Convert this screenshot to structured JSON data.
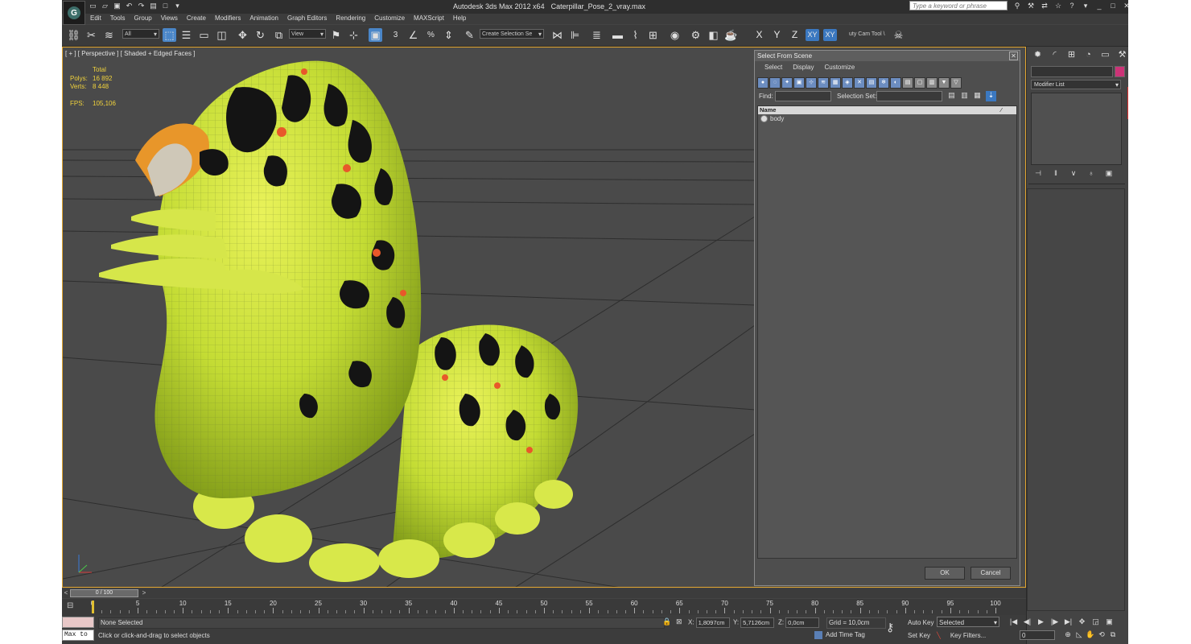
{
  "app": {
    "logo_letter": "G",
    "title": "Autodesk 3ds Max  2012 x64",
    "file": "Caterpillar_Pose_2_vray.max",
    "search_placeholder": "Type a keyword or phrase"
  },
  "menu": [
    "Edit",
    "Tools",
    "Group",
    "Views",
    "Create",
    "Modifiers",
    "Animation",
    "Graph Editors",
    "Rendering",
    "Customize",
    "MAXScript",
    "Help"
  ],
  "toolbar": {
    "filter_value": "All",
    "refcoord_value": "View",
    "selection_set": "Create Selection Se",
    "num_label": "3",
    "axes": [
      "X",
      "Y",
      "Z",
      "XY",
      "XY"
    ],
    "ribbon_label": "uty Cam Tool \\"
  },
  "viewport": {
    "label": "[ + ] [ Perspective ] [ Shaded + Edged Faces ]",
    "stats": {
      "total_label": "Total",
      "polys_label": "Polys:",
      "polys_value": "16 892",
      "verts_label": "Verts:",
      "verts_value": "8 448",
      "fps_label": "FPS:",
      "fps_value": "105,106"
    },
    "gizmo": {
      "x": "x",
      "y": "y",
      "z": "z"
    }
  },
  "dialog": {
    "title": "Select From Scene",
    "menu": [
      "Select",
      "Display",
      "Customize"
    ],
    "find_label": "Find:",
    "selection_set_label": "Selection Set:",
    "column_name": "Name",
    "rows": [
      "body"
    ],
    "ok_label": "OK",
    "cancel_label": "Cancel"
  },
  "command_panel": {
    "modifier_list": "Modifier List"
  },
  "timeline": {
    "slider_label": "0 / 100",
    "ticks": [
      0,
      5,
      10,
      15,
      20,
      25,
      30,
      35,
      40,
      45,
      50,
      55,
      60,
      65,
      70,
      75,
      80,
      85,
      90,
      95,
      100
    ],
    "max_frame": 100
  },
  "status": {
    "max_to": "Max to",
    "selection": "None Selected",
    "prompt": "Click or click-and-drag to select objects",
    "x_label": "X:",
    "x_value": "1,8097cm",
    "y_label": "Y:",
    "y_value": "5,7126cm",
    "z_label": "Z:",
    "z_value": "0,0cm",
    "grid": "Grid = 10,0cm",
    "add_time_tag": "Add Time Tag",
    "auto_key": "Auto Key",
    "set_key": "Set Key",
    "key_mode": "Selected",
    "key_filters": "Key Filters...",
    "frame": "0"
  },
  "colors": {
    "viewport_border": "#e2a630",
    "stats_text": "#f0d23c",
    "active_blue": "#4a86c8",
    "caterpillar_green": "#c9e23a"
  }
}
